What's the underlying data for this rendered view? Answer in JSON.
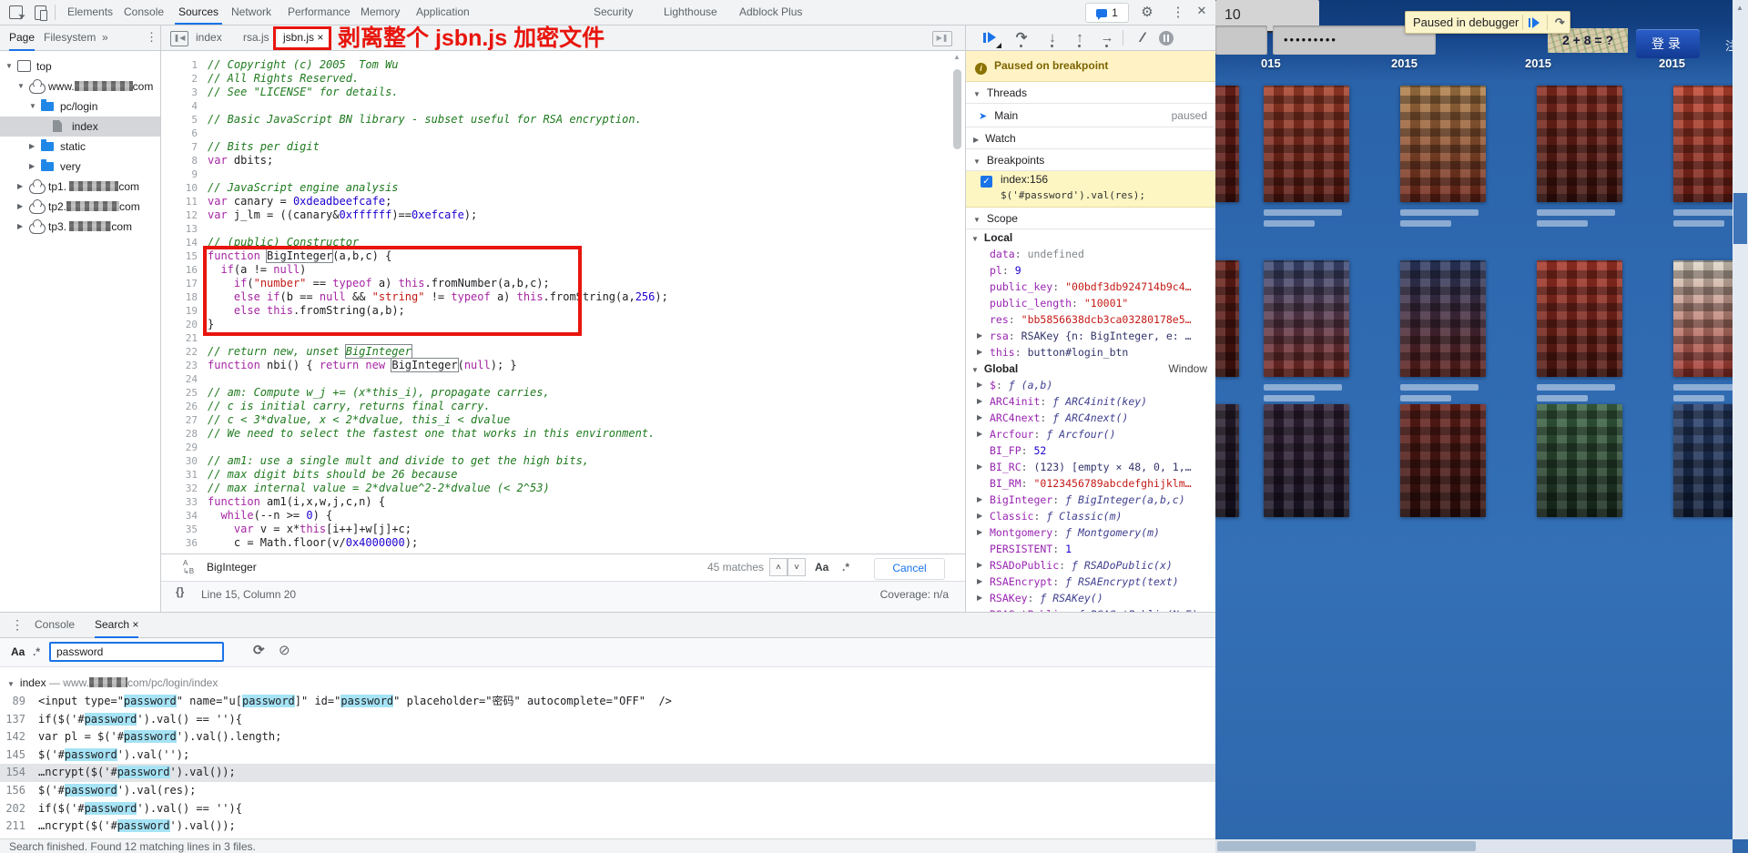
{
  "devtools": {
    "top_tabs": {
      "items": [
        "Elements",
        "Console",
        "Sources",
        "Network",
        "Performance",
        "Memory",
        "Application",
        "Security",
        "Lighthouse",
        "Adblock Plus"
      ],
      "active": "Sources",
      "badge_count": "1"
    },
    "navigator": {
      "tabs": [
        "Page",
        "Filesystem"
      ],
      "active_tab": "Page",
      "overflow_label": "»",
      "tree": [
        {
          "label": "top",
          "icon": "frame",
          "depth": 0,
          "arrow": "expanded"
        },
        {
          "label": "www.",
          "blur_w": 64,
          "suffix": "com",
          "icon": "cloud",
          "depth": 1,
          "arrow": "expanded"
        },
        {
          "label": "pc/login",
          "icon": "folder",
          "depth": 2,
          "arrow": "expanded"
        },
        {
          "label": "index",
          "icon": "file",
          "depth": 3,
          "selected": true
        },
        {
          "label": "static",
          "icon": "folder",
          "depth": 2,
          "arrow": "collapsed"
        },
        {
          "label": "very",
          "icon": "folder",
          "depth": 2,
          "arrow": "collapsed"
        },
        {
          "label": "tp1. ",
          "blur_w": 54,
          "suffix": "com",
          "icon": "cloud",
          "depth": 1,
          "arrow": "collapsed"
        },
        {
          "label": "tp2.",
          "blur_w": 58,
          "suffix": "com",
          "icon": "cloud",
          "depth": 1,
          "arrow": "collapsed"
        },
        {
          "label": "tp3. ",
          "blur_w": 46,
          "suffix": "com",
          "icon": "cloud",
          "depth": 1,
          "arrow": "collapsed"
        }
      ]
    },
    "editor": {
      "file_tabs": [
        "index",
        "rsa.js",
        "jsbn.js"
      ],
      "active_tab": "jsbn.js",
      "close_label": "×",
      "annotation": "剥离整个 jsbn.js 加密文件",
      "code_lines": [
        "// Copyright (c) 2005  Tom Wu",
        "// All Rights Reserved.",
        "// See \"LICENSE\" for details.",
        "",
        "// Basic JavaScript BN library - subset useful for RSA encryption.",
        "",
        "// Bits per digit",
        "var dbits;",
        "",
        "// JavaScript engine analysis",
        "var canary = 0xdeadbeefcafe;",
        "var j_lm = ((canary&0xffffff)==0xefcafe);",
        "",
        "// (public) Constructor",
        "function BigInteger(a,b,c) {",
        "  if(a != null)",
        "    if(\"number\" == typeof a) this.fromNumber(a,b,c);",
        "    else if(b == null && \"string\" != typeof a) this.fromString(a,256);",
        "    else this.fromString(a,b);",
        "}",
        "",
        "// return new, unset BigInteger",
        "function nbi() { return new BigInteger(null); }",
        "",
        "// am: Compute w_j += (x*this_i), propagate carries,",
        "// c is initial carry, returns final carry.",
        "// c < 3*dvalue, x < 2*dvalue, this_i < dvalue",
        "// We need to select the fastest one that works in this environment.",
        "",
        "// am1: use a single mult and divide to get the high bits,",
        "// max digit bits should be 26 because",
        "// max internal value = 2*dvalue^2-2*dvalue (< 2^53)",
        "function am1(i,x,w,j,c,n) {",
        "  while(--n >= 0) {",
        "    var v = x*this[i++]+w[j]+c;",
        "    c = Math.floor(v/0x4000000);"
      ],
      "search_term": "BigInteger",
      "search_match_lines": [
        15,
        22,
        23
      ],
      "find_bar": {
        "query": "BigInteger",
        "matches": "45 matches",
        "prev": "˄",
        "next": "˅",
        "case_label": "Aa",
        "regex_label": ".*",
        "cancel_label": "Cancel"
      },
      "status": {
        "brackets": "{}",
        "position": "Line 15, Column 20",
        "coverage": "Coverage: n/a"
      }
    },
    "debugger": {
      "paused_banner": "Paused on breakpoint",
      "threads_label": "Threads",
      "thread_main": "Main",
      "thread_state": "paused",
      "watch_label": "Watch",
      "breakpoints_label": "Breakpoints",
      "breakpoint_entry": {
        "file": "index:156",
        "code": "$('#password').val(res);"
      },
      "scope_label": "Scope",
      "local_label": "Local",
      "global_label": "Global",
      "window_label": "Window",
      "local": [
        {
          "name": "data",
          "value": "undefined",
          "type": "und"
        },
        {
          "name": "pl",
          "value": "9",
          "type": "num"
        },
        {
          "name": "public_key",
          "value": "\"00bdf3db924714b9c4…",
          "type": "str"
        },
        {
          "name": "public_length",
          "value": "\"10001\"",
          "type": "str"
        },
        {
          "name": "res",
          "value": "\"bb5856638dcb3ca03280178e5…",
          "type": "str"
        },
        {
          "name": "rsa",
          "value": "RSAKey {n: BigInteger, e: …",
          "type": "obj",
          "expandable": true
        },
        {
          "name": "this",
          "value": "button#login_btn",
          "type": "obj",
          "expandable": true
        }
      ],
      "global": [
        {
          "name": "$",
          "value": "ƒ (a,b)",
          "type": "fn",
          "expandable": true
        },
        {
          "name": "ARC4init",
          "value": "ƒ ARC4init(key)",
          "type": "fn",
          "expandable": true
        },
        {
          "name": "ARC4next",
          "value": "ƒ ARC4next()",
          "type": "fn",
          "expandable": true
        },
        {
          "name": "Arcfour",
          "value": "ƒ Arcfour()",
          "type": "fn",
          "expandable": true
        },
        {
          "name": "BI_FP",
          "value": "52",
          "type": "num"
        },
        {
          "name": "BI_RC",
          "value": "(123) [empty × 48, 0, 1,…",
          "type": "obj",
          "expandable": true
        },
        {
          "name": "BI_RM",
          "value": "\"0123456789abcdefghijklm…",
          "type": "str"
        },
        {
          "name": "BigInteger",
          "value": "ƒ BigInteger(a,b,c)",
          "type": "fn",
          "expandable": true
        },
        {
          "name": "Classic",
          "value": "ƒ Classic(m)",
          "type": "fn",
          "expandable": true
        },
        {
          "name": "Montgomery",
          "value": "ƒ Montgomery(m)",
          "type": "fn",
          "expandable": true
        },
        {
          "name": "PERSISTENT",
          "value": "1",
          "type": "num"
        },
        {
          "name": "RSADoPublic",
          "value": "ƒ RSADoPublic(x)",
          "type": "fn",
          "expandable": true
        },
        {
          "name": "RSAEncrypt",
          "value": "ƒ RSAEncrypt(text)",
          "type": "fn",
          "expandable": true
        },
        {
          "name": "RSAKey",
          "value": "ƒ RSAKey()",
          "type": "fn",
          "expandable": true
        },
        {
          "name": "RSASetPublic",
          "value": "ƒ RSASetPublic(N,E)",
          "type": "fn",
          "expandable": true
        }
      ]
    },
    "drawer": {
      "tabs": [
        "Console",
        "Search"
      ],
      "active_tab": "Search",
      "close_label": "×",
      "toolbar": {
        "case_label": "Aa",
        "regex_label": ".*",
        "query": "password"
      },
      "result_header": {
        "file": "index",
        "dash": "—",
        "url_prefix": "www.",
        "blur_w": 42,
        "url_suffix": "com/pc/login/index"
      },
      "highlight": "password",
      "results": [
        {
          "line": "89",
          "text": "<input type=\"password\" name=\"u[password]\" id=\"password\" placeholder=\"密码\" autocomplete=\"OFF\"  />"
        },
        {
          "line": "137",
          "text": "if($('#password').val() == ''){"
        },
        {
          "line": "142",
          "text": "var pl = $('#password').val().length;"
        },
        {
          "line": "145",
          "text": "$('#password').val('');"
        },
        {
          "line": "154",
          "text": "…ncrypt($('#password').val());",
          "selected": true
        },
        {
          "line": "156",
          "text": "$('#password').val(res);"
        },
        {
          "line": "202",
          "text": "if($('#password').val() == ''){"
        },
        {
          "line": "211",
          "text": "…ncrypt($('#password').val());"
        }
      ],
      "status": "Search finished. Found 12 matching lines in 3 files."
    }
  },
  "page": {
    "paused_banner": "Paused in debugger",
    "password_value": "•••••••••",
    "count_value": "10",
    "captcha_text": "2 + 8 = ?",
    "login_label": "登录",
    "partial_char": "注",
    "years": [
      "015",
      "2015",
      "2015",
      "2015"
    ]
  },
  "icons": {
    "settings": "⚙",
    "more": "⋮",
    "close": "✕",
    "step_over": "↷",
    "step_into": "↓",
    "step_out": "↑",
    "step": "→",
    "refresh": "⟳",
    "clear": "⊘",
    "up_arrow": "▲",
    "cursor": "➤",
    "hide_nav": "❚◀",
    "open_drawer": "▶❚",
    "drawer_menu": "⋮"
  },
  "colors": {
    "accent": "#1a73e8",
    "annotation_red": "#e8150d",
    "find_highlight": "#a5e3f5",
    "paused_yellow": "#fff3c5"
  }
}
